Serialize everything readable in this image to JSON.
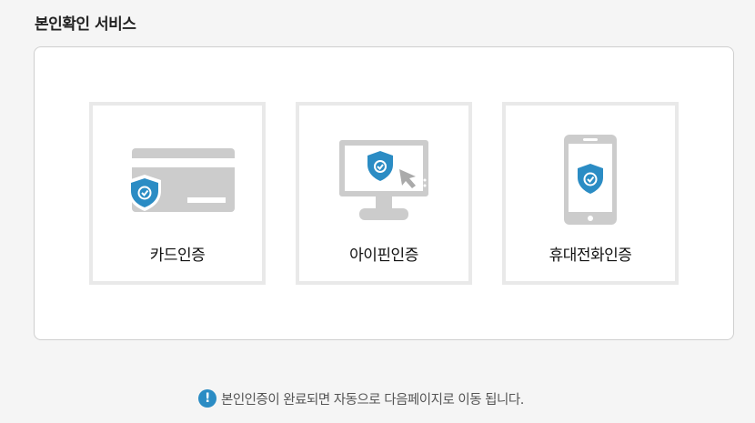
{
  "page": {
    "title": "본인확인 서비스"
  },
  "options": [
    {
      "label": "카드인증",
      "icon": "credit-card-shield-icon"
    },
    {
      "label": "아이핀인증",
      "icon": "monitor-shield-cursor-icon"
    },
    {
      "label": "휴대전화인증",
      "icon": "mobile-phone-shield-icon"
    }
  ],
  "notice": {
    "icon": "exclamation-circle-icon",
    "text": "본인인증이 완료되면 자동으로 다음페이지로 이동 됩니다."
  },
  "colors": {
    "shield": "#2b8cc4",
    "device_gray": "#cccccc",
    "box_border": "#e9e9e9"
  }
}
